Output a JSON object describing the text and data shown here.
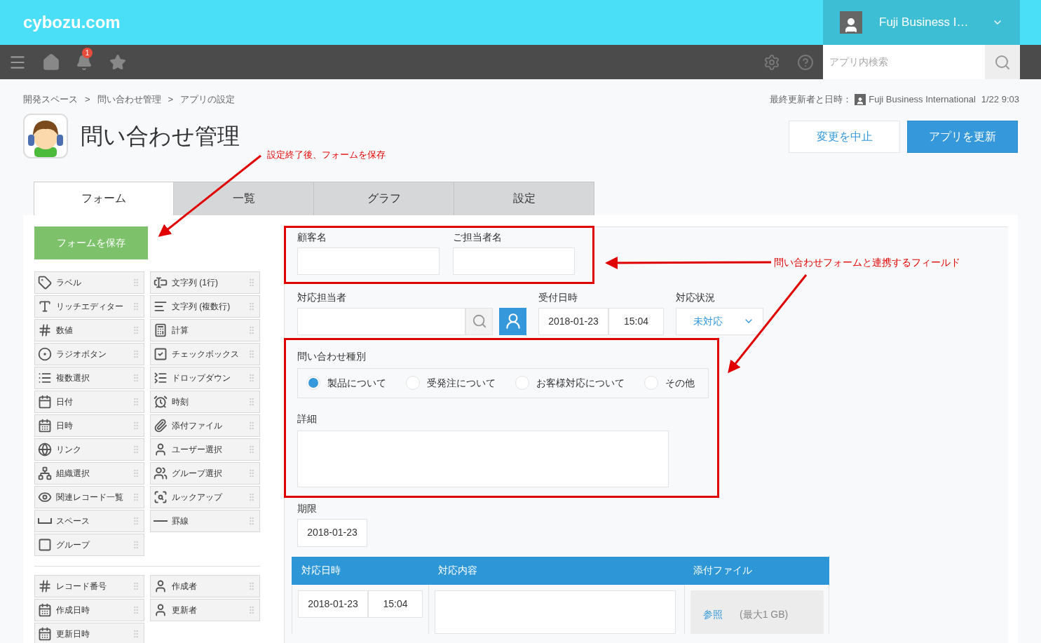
{
  "header": {
    "logo": "cybozu.com",
    "user_name": "Fuji Business I…"
  },
  "nav": {
    "notification_count": "1",
    "search_placeholder": "アプリ内検索"
  },
  "breadcrumb": [
    "開発スペース",
    ">",
    "問い合わせ管理",
    ">",
    "アプリの設定"
  ],
  "last_updated": {
    "label": "最終更新者と日時：",
    "user": "Fuji Business International",
    "time": "1/22 9:03"
  },
  "app_title": "問い合わせ管理",
  "buttons": [
    {
      "label": "変更を中止",
      "kind": "secondary"
    },
    {
      "label": "アプリを更新",
      "kind": "primary"
    }
  ],
  "tabs": [
    {
      "label": "フォーム",
      "selected": true
    },
    {
      "label": "一覧",
      "selected": false
    },
    {
      "label": "グラフ",
      "selected": false
    },
    {
      "label": "設定",
      "selected": false
    }
  ],
  "save_form_button": "フォームを保存",
  "palette": [
    "ラベル",
    "文字列 (1行)",
    "リッチエディター",
    "文字列 (複数行)",
    "数値",
    "計算",
    "ラジオボタン",
    "チェックボックス",
    "複数選択",
    "ドロップダウン",
    "日付",
    "時刻",
    "日時",
    "添付ファイル",
    "リンク",
    "ユーザー選択",
    "組織選択",
    "グループ選択",
    "関連レコード一覧",
    "ルックアップ",
    "スペース",
    "罫線",
    "グループ"
  ],
  "palette_system": [
    "レコード番号",
    "作成者",
    "作成日時",
    "更新者",
    "更新日時"
  ],
  "form": {
    "linked_fields": [
      {
        "label": "顧客名"
      },
      {
        "label": "ご担当者名"
      }
    ],
    "assignee": {
      "label": "対応担当者"
    },
    "received": {
      "label": "受付日時",
      "date": "2018-01-23",
      "time": "15:04"
    },
    "status": {
      "label": "対応状況",
      "value": "未対応"
    },
    "inquiry_type": {
      "label": "問い合わせ種別",
      "options": [
        {
          "label": "製品について",
          "selected": true
        },
        {
          "label": "受発注について",
          "selected": false
        },
        {
          "label": "お客様対応について",
          "selected": false
        },
        {
          "label": "その他",
          "selected": false
        }
      ]
    },
    "detail": {
      "label": "詳細"
    },
    "deadline": {
      "label": "期限",
      "value": "2018-01-23"
    },
    "table": {
      "columns": [
        "対応日時",
        "対応内容",
        "添付ファイル"
      ],
      "rows": [
        {
          "date": "2018-01-23",
          "time": "15:04",
          "file_button": "参照",
          "file_limit": "(最大1 GB)"
        }
      ]
    }
  },
  "annotations": [
    "設定終了後、フォームを保存",
    "問い合わせフォームと連携するフィールド"
  ]
}
